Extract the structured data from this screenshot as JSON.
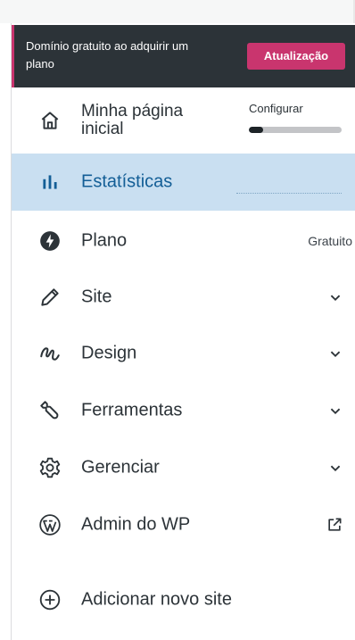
{
  "banner": {
    "text": "Domínio gratuito ao adquirir um plano",
    "upgrade_label": "Atualização"
  },
  "menu": {
    "home": {
      "label": "Minha página inicial",
      "configure_label": "Configurar",
      "progress": 0.15
    },
    "stats": {
      "label": "Estatísticas"
    },
    "plan": {
      "label": "Plano",
      "badge": "Gratuito"
    },
    "site": {
      "label": "Site"
    },
    "design": {
      "label": "Design"
    },
    "tools": {
      "label": "Ferramentas"
    },
    "manage": {
      "label": "Gerenciar"
    },
    "wpadmin": {
      "label": "Admin do WP"
    },
    "add_site": {
      "label": "Adicionar novo site"
    }
  },
  "colors": {
    "banner_bg": "#2c3338",
    "accent": "#c9356e",
    "active_bg": "#c9dff1",
    "active_text": "#135e96"
  },
  "icons": {
    "home": "house-icon",
    "stats": "bar-chart-icon",
    "plan": "plan-icon",
    "site": "pencil-icon",
    "design": "design-icon",
    "tools": "wrench-icon",
    "manage": "gear-icon",
    "wpadmin": "wordpress-icon",
    "add_site": "plus-circle-icon"
  }
}
